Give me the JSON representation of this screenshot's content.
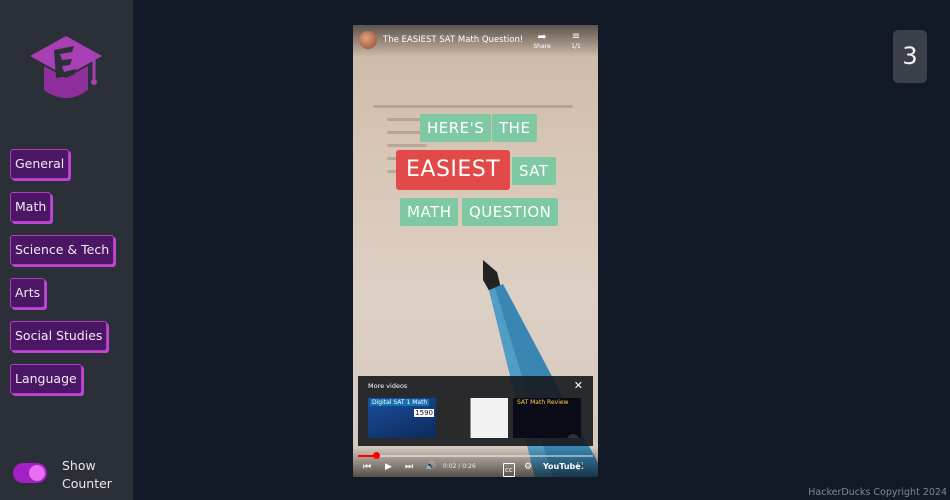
{
  "sidebar": {
    "logo_icon": "graduation-cap-logo",
    "categories": [
      {
        "label": "General"
      },
      {
        "label": "Math"
      },
      {
        "label": "Science & Tech"
      },
      {
        "label": "Arts"
      },
      {
        "label": "Social Studies"
      },
      {
        "label": "Language"
      }
    ],
    "toggle": {
      "label": "Show Counter",
      "checked": true
    }
  },
  "counter": {
    "value": "3"
  },
  "video": {
    "title": "The EASIEST SAT Math Question!",
    "share_label": "Share",
    "playlist_label": "1/1",
    "overlay_words": [
      "HERE'S",
      "THE",
      "EASIEST",
      "SAT",
      "MATH",
      "QUESTION"
    ],
    "more_videos": {
      "title": "More videos",
      "thumbnails": [
        {
          "label": "Digital SAT 1 Math",
          "extra": "1590"
        },
        {
          "label": ""
        },
        {
          "label": "SAT Math Review"
        }
      ]
    },
    "time": "0:02 / 0:26",
    "progress_fraction": 0.077,
    "brand": "YouTube"
  },
  "footer": {
    "copyright": "HackerDucks Copyright 2024"
  },
  "colors": {
    "accent": "#a320c4",
    "button_bg": "#4b1663",
    "sidebar_bg": "#2a2f38",
    "page_bg": "#111a26",
    "chip_green": "#7ec8a4",
    "chip_red": "#e24a4a"
  }
}
